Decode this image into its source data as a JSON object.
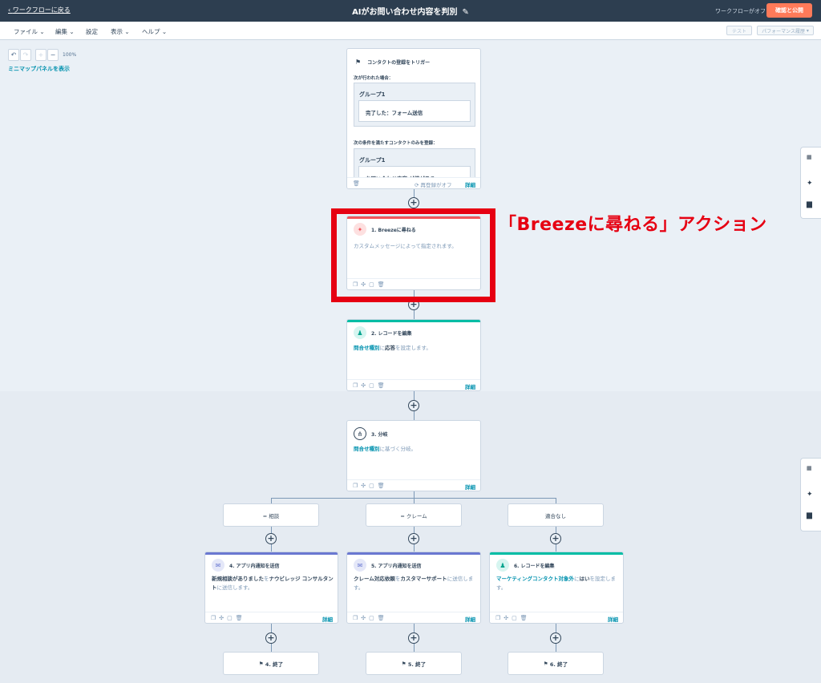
{
  "header": {
    "back_label": "ワークフローに戻る",
    "title": "AIがお問い合わせ内容を判別",
    "status": "ワークフローがオフ",
    "publish_label": "確認と公開"
  },
  "menu": {
    "items": [
      "ファイル",
      "編集",
      "設定",
      "表示",
      "ヘルプ"
    ],
    "test_label": "テスト",
    "performance_label": "パフォーマンス履歴"
  },
  "canvas": {
    "zoom": "100%",
    "minimap_label": "ミニマップパネルを表示"
  },
  "trigger": {
    "title": "コンタクトの登録をトリガー",
    "when_label": "次が行われた場合：",
    "group1_title": "グループ1",
    "group1_item": "完了した：フォーム送信",
    "filter_label": "次の条件を満たすコンタクトのみを登録：",
    "group2_title": "グループ1",
    "group2_item": "お問い合わせ内容 が値がある",
    "re_enroll": "再登録がオフ",
    "detail": "詳細"
  },
  "actions": {
    "a1": {
      "title": "1. Breezeに尋ねる",
      "desc": "カスタムメッセージによって指定されます。"
    },
    "a2": {
      "title": "2. レコードを編集",
      "desc_hl": "問合せ種別",
      "desc_mid": "に",
      "desc_val": "応答",
      "desc_end": "を設定します。",
      "detail": "詳細"
    },
    "a3": {
      "title": "3. 分岐",
      "desc_hl": "問合せ種別",
      "desc_end": "に基づく分岐。",
      "detail": "詳細"
    },
    "a4": {
      "title": "4. アプリ内通知を送信",
      "desc_1": "新規相談がありました",
      "desc_2": "を",
      "desc_3": "ナウビレッジ コンサルタント",
      "desc_4": "に送信します。",
      "detail": "詳細"
    },
    "a5": {
      "title": "5. アプリ内通知を送信",
      "desc_1": "クレーム対応依頼",
      "desc_2": "を",
      "desc_3": "カスタマーサポート",
      "desc_4": "に送信します。",
      "detail": "詳細"
    },
    "a6": {
      "title": "6. レコードを編集",
      "desc_1": "マーケティングコンタクト対象外",
      "desc_2": "に",
      "desc_3": "はい",
      "desc_4": "を設定します。",
      "detail": "詳細"
    }
  },
  "branches": [
    "= 相談",
    "= クレーム",
    "適合なし"
  ],
  "ends": [
    "4. 終了",
    "5. 終了",
    "6. 終了"
  ],
  "annotation": "「Breezeに尋ねる」アクション",
  "colors": {
    "accent": "#ff7a59",
    "link": "#0091ae",
    "annotation": "#e60012",
    "teal": "#00bda5",
    "purple": "#6a78d1",
    "red": "#f2545b"
  }
}
